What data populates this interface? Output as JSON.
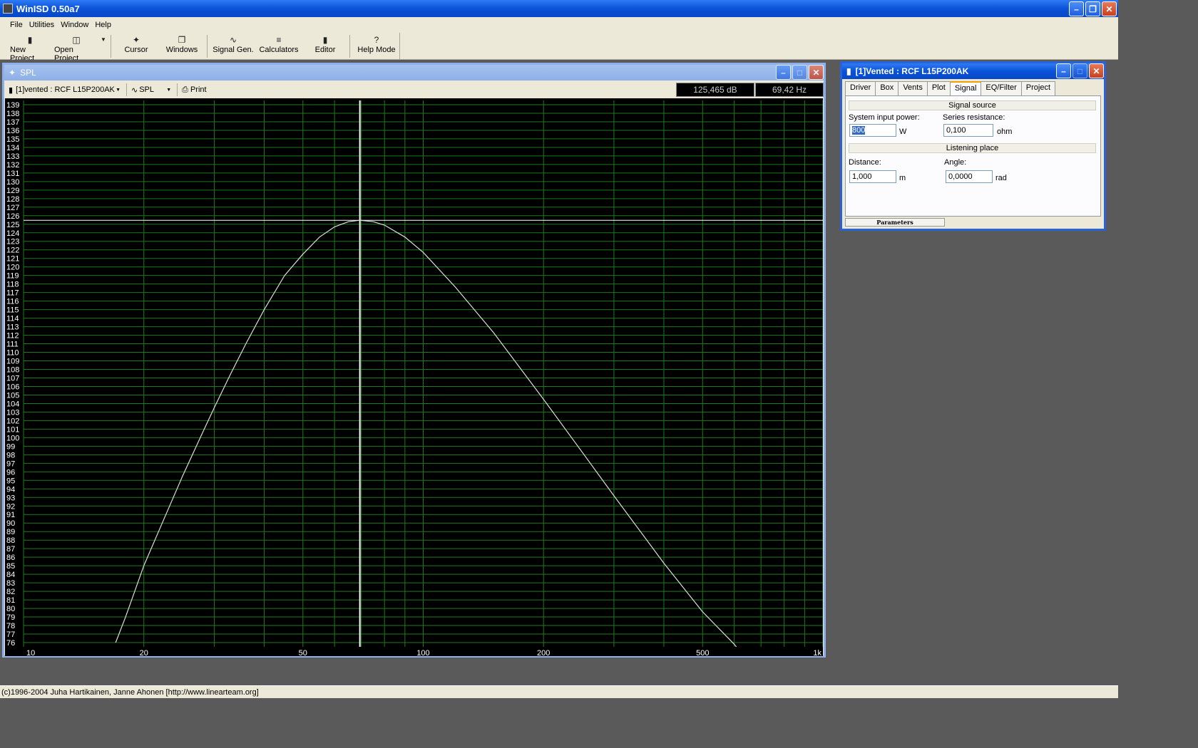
{
  "app": {
    "title": "WinISD 0.50a7"
  },
  "menu": [
    "File",
    "Utilities",
    "Window",
    "Help"
  ],
  "toolbar": {
    "new_project": "New Project",
    "open_project": "Open Project",
    "cursor": "Cursor",
    "windows": "Windows",
    "signal_gen": "Signal Gen.",
    "calculators": "Calculators",
    "editor": "Editor",
    "help_mode": "Help Mode"
  },
  "spl_window": {
    "title": "SPL",
    "project_select": "[1]vented : RCF L15P200AK",
    "plot_select": "SPL",
    "print_label": "Print",
    "readout_db": "125,465 dB",
    "readout_hz": "69,42 Hz"
  },
  "param_window": {
    "title": "[1]Vented : RCF L15P200AK",
    "tabs": [
      "Driver",
      "Box",
      "Vents",
      "Plot",
      "Signal",
      "EQ/Filter",
      "Project"
    ],
    "active_tab": "Signal",
    "signal_source_label": "Signal source",
    "system_input_power_label": "System input power:",
    "system_input_power_value": "800",
    "power_unit": "W",
    "series_resistance_label": "Series resistance:",
    "series_resistance_value": "0,100",
    "resistance_unit": "ohm",
    "listening_place_label": "Listening place",
    "distance_label": "Distance:",
    "distance_value": "1,000",
    "distance_unit": "m",
    "angle_label": "Angle:",
    "angle_value": "0,0000",
    "angle_unit": "rad",
    "bottom_tab": "Parameters"
  },
  "status": {
    "text": "(c)1996-2004 Juha Hartikainen, Janne Ahonen [http://www.linearteam.org]"
  },
  "chart_data": {
    "type": "line",
    "x_scale": "log",
    "xlim": [
      10,
      1000
    ],
    "ylim": [
      75.5,
      139.5
    ],
    "x_tick_labels": [
      "10",
      "20",
      "50",
      "100",
      "200",
      "500",
      "1k"
    ],
    "x_tick_values": [
      10,
      20,
      50,
      100,
      200,
      500,
      1000
    ],
    "y_ticks": [
      76,
      77,
      78,
      79,
      80,
      81,
      82,
      83,
      84,
      85,
      86,
      87,
      88,
      89,
      90,
      91,
      92,
      93,
      94,
      95,
      96,
      97,
      98,
      99,
      100,
      101,
      102,
      103,
      104,
      105,
      106,
      107,
      108,
      109,
      110,
      111,
      112,
      113,
      114,
      115,
      116,
      117,
      118,
      119,
      120,
      121,
      122,
      123,
      124,
      125,
      126,
      127,
      128,
      129,
      130,
      131,
      132,
      133,
      134,
      135,
      136,
      137,
      138,
      139
    ],
    "grid": true,
    "cursor": {
      "x": 69.42,
      "y": 125.465
    },
    "series": [
      {
        "x": [
          17,
          18,
          20,
          22,
          25,
          28,
          30,
          33,
          36,
          40,
          45,
          50,
          55,
          60,
          65,
          69.42,
          75,
          80,
          90,
          100,
          120,
          150,
          200,
          250,
          300,
          400,
          500,
          600,
          650
        ],
        "values": [
          76,
          79,
          85,
          89.5,
          95.5,
          100.5,
          103.5,
          107.5,
          111,
          115,
          119,
          121.5,
          123.5,
          124.7,
          125.3,
          125.465,
          125.3,
          124.9,
          123.5,
          121.7,
          117.7,
          112.3,
          104.5,
          98.3,
          93.2,
          85.3,
          79.6,
          75.8,
          73.8
        ],
        "color": "#dddddd"
      }
    ],
    "colors": {
      "background": "#000000",
      "grid": "#1e7a1e",
      "axis_text": "#ffffff",
      "cursor": "#ffffff"
    }
  }
}
